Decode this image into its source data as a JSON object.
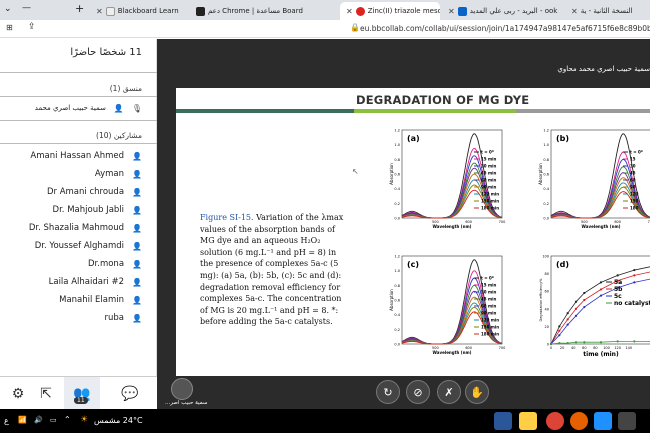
{
  "browser": {
    "tabs": [
      {
        "label": "Blackboard Learn",
        "icon": "blackboard-icon"
      },
      {
        "label": "دعم Chrome | مساعدة Board",
        "icon": "bb-icon"
      },
      {
        "label": "Zinc(II) triazole meso-ar",
        "icon": "record-icon"
      },
      {
        "label": "البريد - ربى علي المديد - ook",
        "icon": "outlook-icon"
      },
      {
        "label": "النسخة الثانية - ية",
        "icon": "doc-icon"
      }
    ],
    "url": "eu.bbcollab.com/collab/ui/session/join/1a174947a98147e5af6715f6e8c89b0b"
  },
  "sidebar": {
    "participants_title": "11 شخصًا حاضرًا",
    "moderator_section": "منسق (1)",
    "moderator": "سمية حبيب اصري محمد",
    "participants_section": "مشاركين (10)",
    "participants": [
      "Amani Hassan Ahmed",
      "Ayman",
      "Dr Amani chrouda",
      "Dr. Mahjoub Jabli",
      "Dr. Shazalia Mahmoud",
      "Dr. Youssef Alghamdi",
      "Dr.mona",
      "Laila Alhaidari #2",
      "Manahil Elamin",
      "ruba"
    ],
    "nav_badge": "11"
  },
  "stage": {
    "presenter_name": "سمية حبيب اصري محمد محاوي",
    "self_name": "سمية حبيب اصر..."
  },
  "slide": {
    "title": "DEGRADATION OF MG DYE",
    "caption_label": "Figure SI-15.",
    "caption_text": "Variation of the λmax values of the absorption bands of MG dye and an aqueous H₂O₂ solution (6 mg.L⁻¹ and pH = 8) in the presence of complexes 5a-c (5 mg): (a) 5a, (b): 5b, (c): 5c and (d): degradation removal efficiency for complexes 5a-c. The concentration of MG is 20 mg.L⁻¹ and pH = 8. *: before adding the 5a-c catalysts.",
    "panel_labels": [
      "(a)",
      "(b)",
      "(c)",
      "(d)"
    ],
    "ylabel_abs": "Absorption",
    "xlabel_abs": "Wavelength (nm)",
    "ylabel_eff": "Degradation efficiency%",
    "xlabel_eff": "time (min)",
    "legend_abc": [
      "t = 0*",
      "15 min",
      "30 min",
      "45 min",
      "60 min",
      "90 min",
      "120 min",
      "150 min",
      "180 min"
    ],
    "legend_b_partial": [
      "t = 0*",
      "15",
      "30",
      "45",
      "60",
      "90",
      "120",
      "150",
      "180"
    ],
    "legend_d": [
      "5a",
      "5b",
      "5c",
      "no catalyst"
    ],
    "colors": [
      "#222222",
      "#e0218a",
      "#2b2bcc",
      "#3a7d2c",
      "#6a2c91",
      "#c46a00",
      "#1c8aa6",
      "#7f7f00",
      "#cc2222"
    ]
  },
  "chart_data": [
    {
      "type": "line",
      "title": "(a)",
      "xlabel": "Wavelength (nm)",
      "ylabel": "Absorption",
      "xlim": [
        400,
        700
      ],
      "ylim": [
        0,
        1.2
      ],
      "series": [
        {
          "name": "t = 0*",
          "peak": 1.15
        },
        {
          "name": "15 min",
          "peak": 0.95
        },
        {
          "name": "30 min",
          "peak": 0.85
        },
        {
          "name": "45 min",
          "peak": 0.75
        },
        {
          "name": "60 min",
          "peak": 0.68
        },
        {
          "name": "90 min",
          "peak": 0.6
        },
        {
          "name": "120 min",
          "peak": 0.52
        },
        {
          "name": "150 min",
          "peak": 0.45
        },
        {
          "name": "180 min",
          "peak": 0.38
        }
      ]
    },
    {
      "type": "line",
      "title": "(b)",
      "xlabel": "Wavelength (nm)",
      "ylabel": "Absorption",
      "xlim": [
        400,
        700
      ],
      "ylim": [
        0,
        1.2
      ],
      "series": [
        {
          "name": "t = 0*",
          "peak": 1.15
        },
        {
          "name": "15",
          "peak": 0.9
        },
        {
          "name": "30",
          "peak": 0.8
        },
        {
          "name": "45",
          "peak": 0.7
        },
        {
          "name": "60",
          "peak": 0.62
        },
        {
          "name": "90",
          "peak": 0.55
        },
        {
          "name": "120",
          "peak": 0.48
        },
        {
          "name": "150",
          "peak": 0.42
        },
        {
          "name": "180",
          "peak": 0.36
        }
      ]
    },
    {
      "type": "line",
      "title": "(c)",
      "xlabel": "Wavelength (nm)",
      "ylabel": "Absorption",
      "xlim": [
        400,
        700
      ],
      "ylim": [
        0,
        1.2
      ],
      "series": [
        {
          "name": "t = 0*",
          "peak": 1.15
        },
        {
          "name": "15 min",
          "peak": 1.0
        },
        {
          "name": "30 min",
          "peak": 0.9
        },
        {
          "name": "45 min",
          "peak": 0.8
        },
        {
          "name": "60 min",
          "peak": 0.72
        },
        {
          "name": "90 min",
          "peak": 0.64
        },
        {
          "name": "120 min",
          "peak": 0.56
        },
        {
          "name": "150 min",
          "peak": 0.5
        },
        {
          "name": "180 min",
          "peak": 0.44
        }
      ]
    },
    {
      "type": "line",
      "title": "(d)",
      "xlabel": "time (min)",
      "ylabel": "Degradation efficiency%",
      "xlim": [
        0,
        180
      ],
      "ylim": [
        0,
        100
      ],
      "x": [
        0,
        15,
        30,
        45,
        60,
        90,
        120,
        150,
        180
      ],
      "series": [
        {
          "name": "5a",
          "values": [
            0,
            20,
            35,
            48,
            58,
            70,
            78,
            84,
            88
          ]
        },
        {
          "name": "5b",
          "values": [
            0,
            15,
            28,
            40,
            50,
            62,
            72,
            78,
            82
          ]
        },
        {
          "name": "5c",
          "values": [
            0,
            10,
            22,
            32,
            42,
            55,
            64,
            70,
            74
          ]
        },
        {
          "name": "no catalyst",
          "values": [
            0,
            1,
            1,
            2,
            2,
            2,
            3,
            3,
            3
          ]
        }
      ]
    }
  ],
  "taskbar": {
    "weather": "24°C مشمس",
    "lang": "ع"
  }
}
